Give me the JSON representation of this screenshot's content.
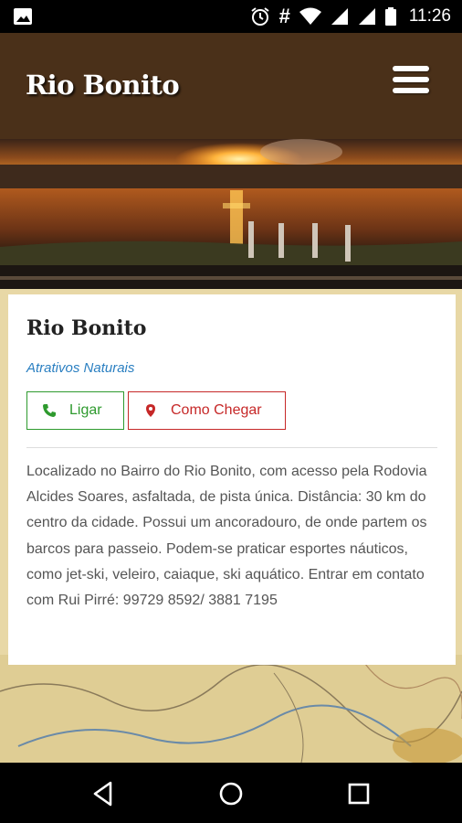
{
  "status_bar": {
    "time": "11:26",
    "hash": "#",
    "icons": [
      "image-icon",
      "alarm-icon",
      "hash-icon",
      "wifi-icon",
      "signal-icon",
      "signal-icon",
      "battery-icon"
    ]
  },
  "header": {
    "title": "Rio Bonito",
    "menu_icon": "hamburger-menu-icon"
  },
  "attraction": {
    "title": "Rio Bonito",
    "category": "Atrativos Naturais",
    "call_label": "Ligar",
    "route_label": "Como Chegar",
    "description": "Localizado no Bairro do Rio Bonito, com acesso pela Rodovia Alcides Soares, asfaltada, de pista única. Distância: 30 km do centro da cidade. Possui um ancoradouro, de onde partem os barcos para passeio. Podem-se praticar esportes náuticos, como jet-ski, veleiro, caiaque, ski aquático. Entrar em contato com Rui Pirré: 99729 8592/ 3881 7195"
  },
  "nav": {
    "back_icon": "back-triangle-icon",
    "home_icon": "home-circle-icon",
    "recents_icon": "recents-square-icon"
  },
  "colors": {
    "header_bg": "#4a3019",
    "call_green": "#2e9a2e",
    "route_red": "#c62828",
    "category_blue": "#2a7fc1"
  }
}
